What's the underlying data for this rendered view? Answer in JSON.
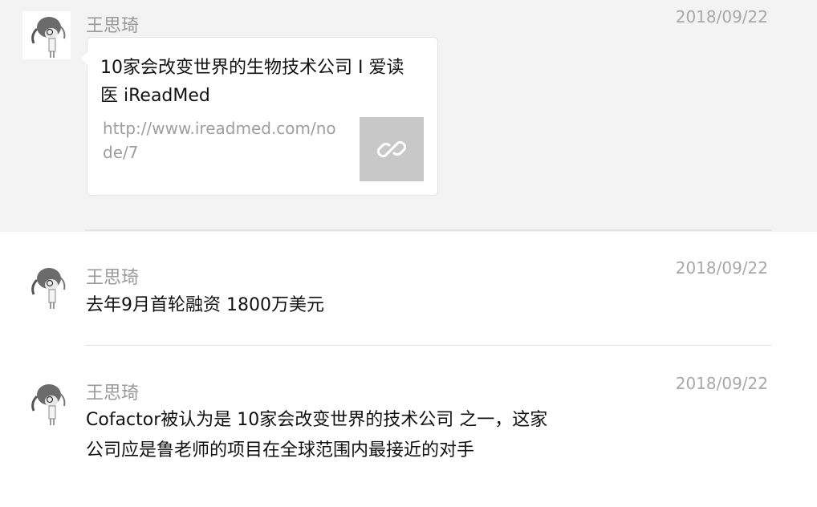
{
  "messages": [
    {
      "sender": "王思琦",
      "date": "2018/09/22",
      "avatar_icon": "cartoon-girl-avatar-icon",
      "link": {
        "title": "10家会改变世界的生物技术公司 I 爱读医 iReadMed",
        "url": "http://www.ireadmed.com/node/7",
        "thumb_icon": "link-chain-icon"
      }
    },
    {
      "sender": "王思琦",
      "date": "2018/09/22",
      "avatar_icon": "cartoon-girl-avatar-icon",
      "text": "去年9月首轮融资 1800万美元"
    },
    {
      "sender": "王思琦",
      "date": "2018/09/22",
      "avatar_icon": "cartoon-girl-avatar-icon",
      "text": "Cofactor被认为是 10家会改变世界的技术公司 之一，这家公司应是鲁老师的项目在全球范围内最接近的对手"
    }
  ],
  "colors": {
    "highlight_bg": "#f3f3f3",
    "sender": "#9a9a9a",
    "date": "#a8a8a8",
    "thumb_bg": "#c8c8c8"
  }
}
